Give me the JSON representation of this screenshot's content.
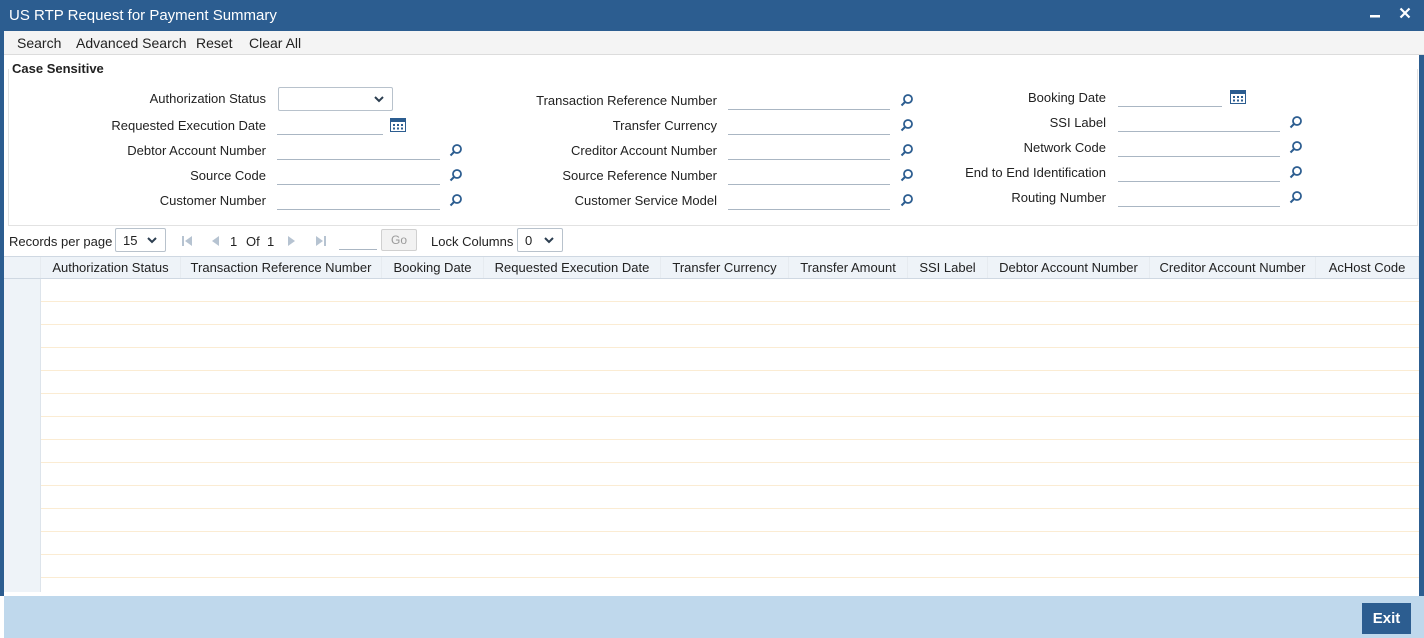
{
  "window": {
    "title": "US RTP Request for Payment Summary",
    "minimize_symbol": "▬",
    "close_symbol": "✕"
  },
  "menu": {
    "search": "Search",
    "advanced_search": "Advanced Search",
    "reset": "Reset",
    "clear_all": "Clear All"
  },
  "criteria": {
    "legend": "Case Sensitive",
    "authorization_status": {
      "label": "Authorization Status",
      "value": ""
    },
    "requested_execution_date": {
      "label": "Requested Execution Date",
      "value": ""
    },
    "debtor_account_number": {
      "label": "Debtor Account Number",
      "value": ""
    },
    "source_code": {
      "label": "Source Code",
      "value": ""
    },
    "customer_number": {
      "label": "Customer Number",
      "value": ""
    },
    "transaction_reference_number": {
      "label": "Transaction Reference Number",
      "value": ""
    },
    "transfer_currency": {
      "label": "Transfer Currency",
      "value": ""
    },
    "creditor_account_number": {
      "label": "Creditor Account Number",
      "value": ""
    },
    "source_reference_number": {
      "label": "Source Reference Number",
      "value": ""
    },
    "customer_service_model": {
      "label": "Customer Service Model",
      "value": ""
    },
    "booking_date": {
      "label": "Booking Date",
      "value": ""
    },
    "ssi_label": {
      "label": "SSI Label",
      "value": ""
    },
    "network_code": {
      "label": "Network Code",
      "value": ""
    },
    "end_to_end_identification": {
      "label": "End to End Identification",
      "value": ""
    },
    "routing_number": {
      "label": "Routing Number",
      "value": ""
    }
  },
  "pager": {
    "records_per_page_label": "Records per page",
    "records_per_page_value": "15",
    "current_page": "1",
    "of_label": "Of",
    "total_pages": "1",
    "go_label": "Go",
    "lock_columns_label": "Lock Columns",
    "lock_columns_value": "0"
  },
  "grid": {
    "columns": [
      "Authorization Status",
      "Transaction Reference Number",
      "Booking Date",
      "Requested Execution Date",
      "Transfer Currency",
      "Transfer Amount",
      "SSI Label",
      "Debtor Account Number",
      "Creditor Account Number",
      "AcHost Code"
    ],
    "rows": []
  },
  "footer": {
    "exit_label": "Exit"
  },
  "icons": {
    "search": "search-icon",
    "calendar": "calendar-icon",
    "dropdown": "chevron-down-icon"
  },
  "colors": {
    "titlebar": "#2c5d90",
    "footer": "#bfd8ec",
    "grid_header": "#eef3f8"
  }
}
